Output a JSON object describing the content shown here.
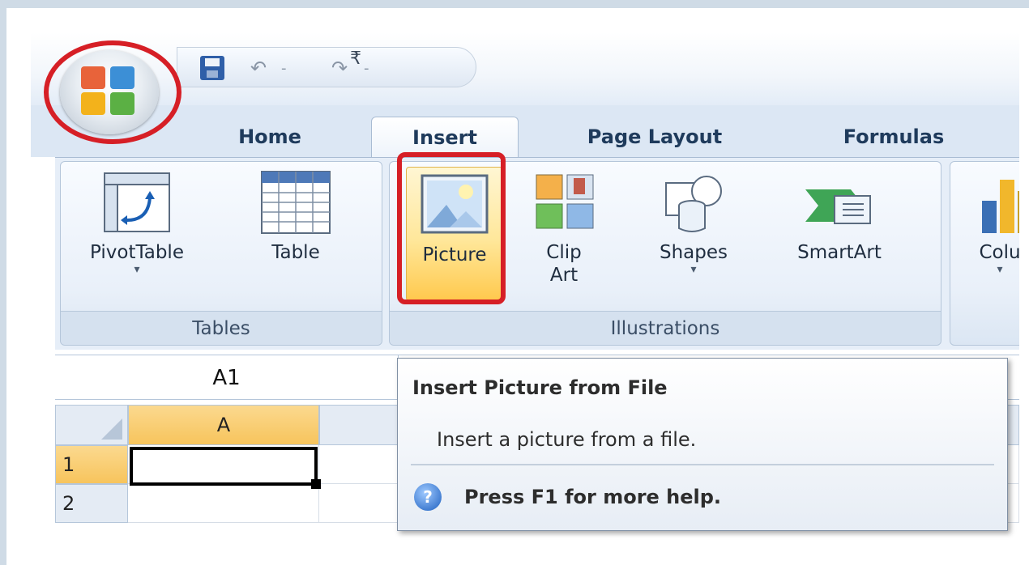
{
  "qat": {
    "undo_glyph": "↶",
    "redo_glyph": "↷",
    "dropdown_glyph": "-",
    "customize_glyph": "₹"
  },
  "tabs": [
    {
      "label": "Home"
    },
    {
      "label": "Insert"
    },
    {
      "label": "Page Layout"
    },
    {
      "label": "Formulas"
    }
  ],
  "ribbon": {
    "groups": {
      "tables": {
        "label": "Tables",
        "buttons": [
          {
            "label": "PivotTable",
            "arrow": "▾"
          },
          {
            "label": "Table"
          }
        ]
      },
      "illustrations": {
        "label": "Illustrations",
        "buttons": [
          {
            "label": "Picture"
          },
          {
            "label": "Clip\nArt"
          },
          {
            "label": "Shapes",
            "arrow": "▾"
          },
          {
            "label": "SmartArt"
          }
        ]
      },
      "charts": {
        "buttons": [
          {
            "label": "Colu",
            "arrow": "▾"
          }
        ]
      }
    }
  },
  "formula_bar": {
    "name_box": "A1"
  },
  "grid": {
    "columns": [
      "A"
    ],
    "rows": [
      "1",
      "2"
    ]
  },
  "tooltip": {
    "title": "Insert Picture from File",
    "description": "Insert a picture from a file.",
    "help": "Press F1 for more help.",
    "help_glyph": "?"
  },
  "colors": {
    "annotation": "#d61f26",
    "active_tab": "#ffffff",
    "ribbon": "#e6eef8",
    "selected_header": "#f7c45c"
  }
}
